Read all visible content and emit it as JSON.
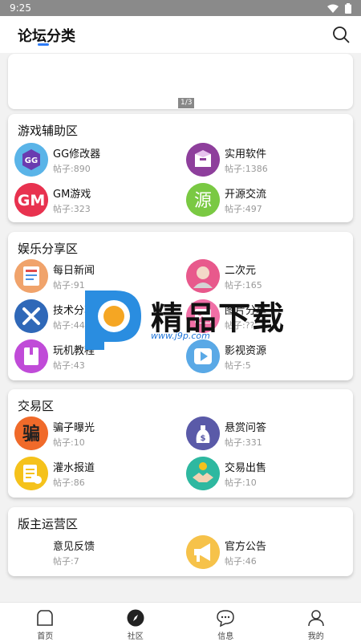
{
  "status": {
    "time": "9:25"
  },
  "header": {
    "title": "论坛分类"
  },
  "banner": {
    "indicator": "1/3"
  },
  "sections": [
    {
      "title": "游戏辅助区",
      "items": [
        {
          "name": "GG修改器",
          "count": "帖子:890",
          "icon": "gg-modifier-icon"
        },
        {
          "name": "实用软件",
          "count": "帖子:1386",
          "icon": "software-box-icon"
        },
        {
          "name": "GM游戏",
          "count": "帖子:323",
          "icon": "gm-game-icon"
        },
        {
          "name": "开源交流",
          "count": "帖子:497",
          "icon": "open-source-icon"
        }
      ]
    },
    {
      "title": "娱乐分享区",
      "items": [
        {
          "name": "每日新闻",
          "count": "帖子:91",
          "icon": "news-icon"
        },
        {
          "name": "二次元",
          "count": "帖子:165",
          "icon": "anime-icon"
        },
        {
          "name": "技术分享",
          "count": "帖子:44",
          "icon": "tools-icon"
        },
        {
          "name": "图片分享",
          "count": "帖子:??",
          "icon": "image-icon"
        },
        {
          "name": "玩机教程",
          "count": "帖子:43",
          "icon": "tutorial-book-icon"
        },
        {
          "name": "影视资源",
          "count": "帖子:5",
          "icon": "video-play-icon"
        }
      ]
    },
    {
      "title": "交易区",
      "items": [
        {
          "name": "骗子曝光",
          "count": "帖子:10",
          "icon": "scam-icon"
        },
        {
          "name": "悬赏问答",
          "count": "帖子:331",
          "icon": "bounty-bag-icon"
        },
        {
          "name": "灌水报道",
          "count": "帖子:86",
          "icon": "report-doc-icon"
        },
        {
          "name": "交易出售",
          "count": "帖子:10",
          "icon": "handshake-icon"
        }
      ]
    },
    {
      "title": "版主运营区",
      "items": [
        {
          "name": "意见反馈",
          "count": "帖子:7",
          "icon": "feedback-icon"
        },
        {
          "name": "官方公告",
          "count": "帖子:46",
          "icon": "megaphone-icon"
        }
      ]
    }
  ],
  "watermark": {
    "text": "精品下载",
    "url": "www.j9p.com"
  },
  "nav": [
    {
      "label": "首页",
      "icon": "home-icon"
    },
    {
      "label": "社区",
      "icon": "compass-icon"
    },
    {
      "label": "信息",
      "icon": "message-icon"
    },
    {
      "label": "我的",
      "icon": "user-icon"
    }
  ]
}
